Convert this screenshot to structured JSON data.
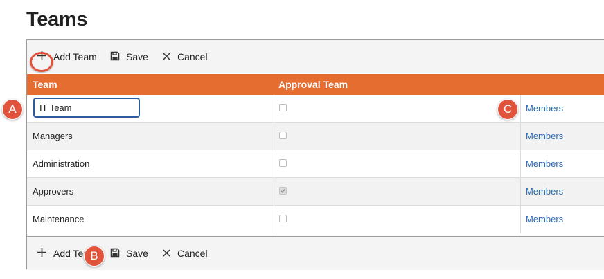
{
  "page": {
    "title": "Teams"
  },
  "toolbar": {
    "add_label": "Add Team",
    "save_label": "Save",
    "cancel_label": "Cancel"
  },
  "columns": {
    "team": "Team",
    "approval": "Approval Team"
  },
  "editing": {
    "value": "IT Team"
  },
  "rows": [
    {
      "team": "IT Team",
      "approval": false,
      "members": "Members"
    },
    {
      "team": "Managers",
      "approval": false,
      "members": "Members"
    },
    {
      "team": "Administration",
      "approval": false,
      "members": "Members"
    },
    {
      "team": "Approvers",
      "approval": true,
      "members": "Members"
    },
    {
      "team": "Maintenance",
      "approval": false,
      "members": "Members"
    }
  ],
  "callouts": {
    "a": "A",
    "b": "B",
    "c": "C"
  },
  "colors": {
    "header": "#e46d2f",
    "callout": "#e2533d",
    "link": "#2a6bb0",
    "focus": "#2d5b9f"
  },
  "icons": {
    "add": "plus-icon",
    "save": "save-icon",
    "cancel": "close-icon"
  }
}
